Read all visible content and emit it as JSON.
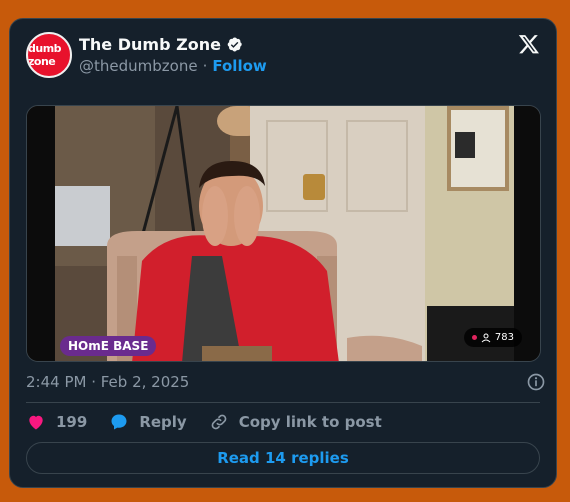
{
  "author": {
    "name": "The Dumb Zone",
    "handle": "@thedumbzone",
    "separator": "·",
    "follow_label": "Follow",
    "avatar_text": "dumb zone"
  },
  "media": {
    "overlay_label": "HOmE BASE",
    "viewer_count": "783"
  },
  "timestamp": "2:44 PM · Feb 2, 2025",
  "actions": {
    "likes": "199",
    "reply_label": "Reply",
    "copy_label": "Copy link to post"
  },
  "read_replies": "Read 14 replies",
  "colors": {
    "page_bg": "#c75a0b",
    "card_bg": "#15202b",
    "accent": "#1d9bf0",
    "like": "#f91880"
  },
  "icons": [
    "verified-icon",
    "x-logo-icon",
    "info-icon",
    "heart-icon",
    "reply-icon",
    "link-icon",
    "viewer-icon"
  ]
}
